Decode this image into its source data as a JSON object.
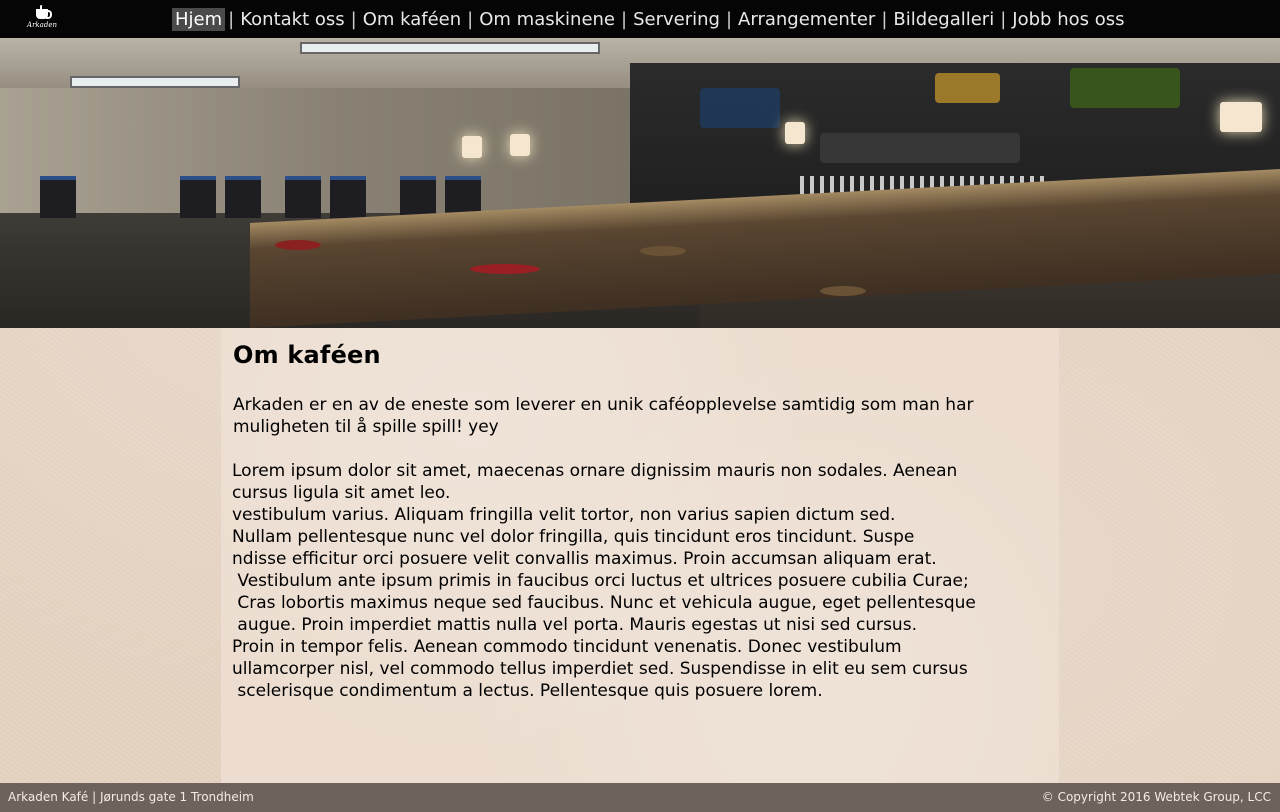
{
  "logo": {
    "icon": "coffee-cup-icon",
    "text": "Arkaden"
  },
  "nav": {
    "items": [
      {
        "label": "Hjem",
        "active": true
      },
      {
        "label": "Kontakt oss",
        "active": false
      },
      {
        "label": "Om kaféen",
        "active": false
      },
      {
        "label": "Om maskinene",
        "active": false
      },
      {
        "label": "Servering",
        "active": false
      },
      {
        "label": "Arrangementer",
        "active": false
      },
      {
        "label": "Bildegalleri",
        "active": false
      },
      {
        "label": "Jobb hos oss",
        "active": false
      }
    ],
    "separator": "|"
  },
  "main": {
    "title": "Om kaféen",
    "intro": "Arkaden er en av de eneste som leverer en unik caféopplevelse samtidig som man har muligheten til å spille spill! yey",
    "lorem_lines": [
      "Lorem ipsum dolor sit amet, maecenas ornare dignissim mauris non sodales. Aenean",
      "cursus ligula sit amet leo.",
      "vestibulum varius. Aliquam fringilla velit tortor, non varius sapien dictum sed.",
      "Nullam pellentesque nunc vel dolor fringilla, quis tincidunt eros tincidunt. Suspe",
      "ndisse efficitur orci posuere velit convallis maximus. Proin accumsan aliquam erat.",
      " Vestibulum ante ipsum primis in faucibus orci luctus et ultrices posuere cubilia Curae;",
      " Cras lobortis maximus neque sed faucibus. Nunc et vehicula augue, eget pellentesque",
      " augue. Proin imperdiet mattis nulla vel porta. Mauris egestas ut nisi sed cursus.",
      "Proin in tempor felis. Aenean commodo tincidunt venenatis. Donec vestibulum",
      "ullamcorper nisl, vel commodo tellus imperdiet sed. Suspendisse in elit eu sem cursus",
      " scelerisque condimentum a lectus. Pellentesque quis posuere lorem."
    ]
  },
  "footer": {
    "left": "Arkaden Kafé | Jørunds gate 1 Trondheim",
    "right": "© Copyright 2016 Webtek Group, LCC"
  },
  "colors": {
    "topbar": "#050505",
    "nav_active_bg": "#4a4a4a",
    "page_bg": "#e6d3c2",
    "content_bg": "#ecddd0",
    "footer_bg": "#6e635b"
  }
}
